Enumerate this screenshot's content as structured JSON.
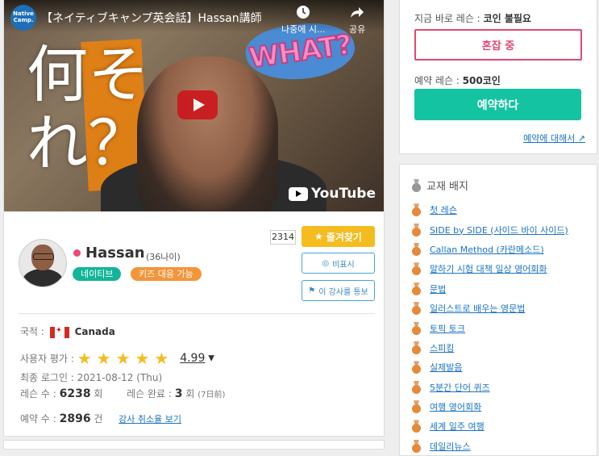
{
  "video": {
    "channel_logo": "Native Camp.",
    "title": "【ネイティブキャンプ英会話】Hassan講師",
    "watch_later": "나중에 시...",
    "share": "공유",
    "overlay_text_1": "何そ",
    "overlay_text_2": "れ？",
    "badge_text": "WHAT?",
    "youtube": "YouTube"
  },
  "teacher": {
    "name": "Hassan",
    "age": "(36나이)",
    "tags": [
      "네이티브",
      "키즈 대응 가능"
    ],
    "favorite_count": "2314",
    "favorite_label": "즐겨찾기",
    "hide_label": "비표시",
    "report_label": "이 강사를 통보",
    "nationality_label": "국적 :",
    "nationality": "Canada",
    "rating_label": "사용자 평가 :",
    "rating": "4.99",
    "last_login_label": "최종 로그인 :",
    "last_login": "2021-08-12 (Thu)",
    "lessons_label": "레슨 수 :",
    "lessons": "6238",
    "lessons_unit": "회",
    "completed_label": "레슨 완료 :",
    "completed": "3",
    "completed_unit": "회",
    "completed_note": "(7日前)",
    "reservations_label": "예약 수 :",
    "reservations": "2896",
    "reservations_unit": "건",
    "cancel_link": "강사 취소율 보기"
  },
  "booking": {
    "now_label": "지금 바로 레슨 :",
    "now_value": "코인 불필요",
    "busy_button": "혼잡 중",
    "reserve_label": "예약 레슨 :",
    "reserve_coins": "500",
    "reserve_coins_unit": "코인",
    "reserve_button": "예약하다",
    "about_link": "예약에 대해서"
  },
  "badges": {
    "title": "교재 배지",
    "items": [
      "첫 레슨",
      "SIDE by SIDE (사이드 바이 사이드)",
      "Callan Method (카란메소드)",
      "말하기 시험 대책 일상 영어회화",
      "문법",
      "일러스트로 배우는 영문법",
      "토픽 토크",
      "스피킹",
      "실제발음",
      "5분간 단어 퀴즈",
      "여행 영어회화",
      "세계 일주 여행",
      "데일리뉴스"
    ]
  },
  "colors": {
    "accent_green": "#13c3a1",
    "busy_pink": "#e24872",
    "favorite_yellow": "#f5bc20",
    "tag_teal": "#13b59a",
    "tag_orange": "#f5953b"
  }
}
